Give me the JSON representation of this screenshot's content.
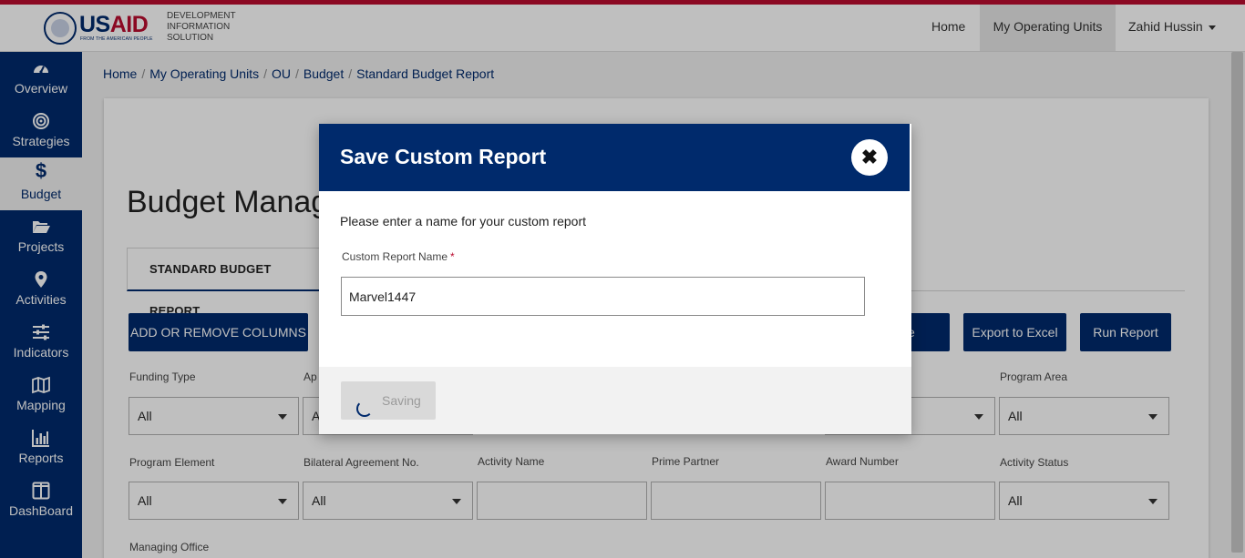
{
  "brand": {
    "wordmark_us": "US",
    "wordmark_aid": "AID",
    "tagline": "FROM THE AMERICAN PEOPLE",
    "system_lines": [
      "DEVELOPMENT",
      "INFORMATION",
      "SOLUTION"
    ]
  },
  "topnav": {
    "home": "Home",
    "operating_units": "My Operating Units",
    "user": "Zahid Hussin"
  },
  "sidebar": {
    "items": [
      {
        "label": "Overview",
        "icon": "dashboard-gauge-icon"
      },
      {
        "label": "Strategies",
        "icon": "target-icon"
      },
      {
        "label": "Budget",
        "icon": "dollar-icon"
      },
      {
        "label": "Projects",
        "icon": "folder-open-icon"
      },
      {
        "label": "Activities",
        "icon": "map-pin-icon"
      },
      {
        "label": "Indicators",
        "icon": "sliders-icon"
      },
      {
        "label": "Mapping",
        "icon": "map-icon"
      },
      {
        "label": "Reports",
        "icon": "bar-chart-icon"
      },
      {
        "label": "DashBoard",
        "icon": "columns-icon"
      }
    ],
    "active": "Budget"
  },
  "breadcrumb": [
    "Home",
    "My Operating Units",
    "OU",
    "Budget",
    "Standard Budget Report"
  ],
  "page": {
    "title": "Budget Manag",
    "tab": "STANDARD BUDGET REPORT",
    "buttons": {
      "add_remove_columns": "ADD OR REMOVE COLUMNS",
      "save_partial": "e",
      "export_excel": "Export to Excel",
      "run_report": "Run Report"
    },
    "filters": {
      "funding_type": {
        "label": "Funding Type",
        "value": "All"
      },
      "appropriation": {
        "label": "Ap",
        "value": "A"
      },
      "program_area": {
        "label": "Program Area",
        "value": "All"
      },
      "hidden_select": {
        "value": ""
      },
      "program_element": {
        "label": "Program Element",
        "value": "All"
      },
      "bilateral_agreement": {
        "label": "Bilateral Agreement No.",
        "value": "All"
      },
      "activity_name": {
        "label": "Activity Name",
        "value": ""
      },
      "prime_partner": {
        "label": "Prime Partner",
        "value": ""
      },
      "award_number": {
        "label": "Award Number",
        "value": ""
      },
      "activity_status": {
        "label": "Activity Status",
        "value": "All"
      },
      "managing_office": {
        "label": "Managing Office"
      }
    }
  },
  "modal": {
    "title": "Save Custom Report",
    "prompt": "Please enter a name for your custom report",
    "field_label": "Custom Report Name",
    "required_mark": "*",
    "field_value": "Marvel1447",
    "saving_label": "Saving"
  },
  "colors": {
    "brand_blue": "#002a6c",
    "brand_red": "#ba0c2f"
  }
}
